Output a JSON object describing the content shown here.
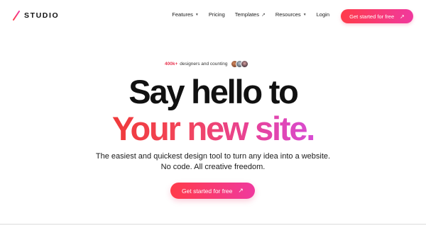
{
  "brand": {
    "logo_text": "STUDIO",
    "accent_start": "#ff3b4a",
    "accent_end": "#f0399e"
  },
  "nav": {
    "items": [
      {
        "label": "Features",
        "icon": "chevron-down-icon"
      },
      {
        "label": "Pricing"
      },
      {
        "label": "Templates",
        "icon": "arrow-up-right-icon"
      },
      {
        "label": "Resources",
        "icon": "chevron-down-icon"
      },
      {
        "label": "Login"
      }
    ],
    "cta_label": "Get started for free",
    "cta_icon": "arrow-up-right-icon"
  },
  "badge": {
    "count": "400k+",
    "text": "designers and counting"
  },
  "hero": {
    "line1": "Say hello to",
    "line2": "Your new site."
  },
  "subtitle": {
    "line1": "The easiest and quickest design tool to turn any idea into a website.",
    "line2": "No code. All creative freedom."
  },
  "cta": {
    "label": "Get started for free",
    "icon": "arrow-up-right-icon"
  }
}
